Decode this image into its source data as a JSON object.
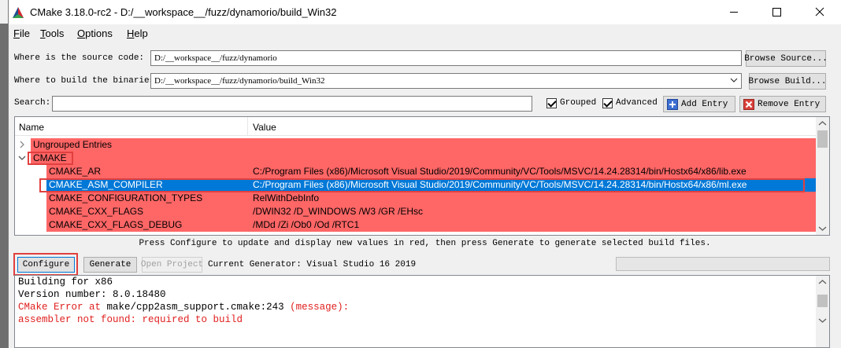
{
  "window": {
    "title": "CMake 3.18.0-rc2 - D:/__workspace__/fuzz/dynamorio/build_Win32"
  },
  "menu": [
    {
      "label": "File",
      "accel": "F",
      "rest": "ile"
    },
    {
      "label": "Tools",
      "accel": "T",
      "rest": "ools"
    },
    {
      "label": "Options",
      "accel": "O",
      "rest": "ptions"
    },
    {
      "label": "Help",
      "accel": "H",
      "rest": "elp"
    }
  ],
  "source": {
    "label": "Where is the source code:",
    "value": "D:/__workspace__/fuzz/dynamorio",
    "browse": "Browse Source..."
  },
  "build": {
    "label": "Where to build the binaries:",
    "value": "D:/__workspace__/fuzz/dynamorio/build_Win32",
    "browse": "Browse Build..."
  },
  "search": {
    "label": "Search:",
    "value": "",
    "grouped": {
      "label": "Grouped",
      "checked": true
    },
    "advanced": {
      "label": "Advanced",
      "checked": true
    },
    "add_entry": "Add Entry",
    "remove_entry": "Remove Entry"
  },
  "tree": {
    "headers": {
      "name": "Name",
      "value": "Value"
    },
    "groups": [
      {
        "name": "Ungrouped Entries",
        "expanded": false
      },
      {
        "name": "CMAKE",
        "expanded": true
      }
    ],
    "rows": [
      {
        "name": "CMAKE_AR",
        "value": "C:/Program Files (x86)/Microsoft Visual Studio/2019/Community/VC/Tools/MSVC/14.24.28314/bin/Hostx64/x86/lib.exe",
        "selected": false
      },
      {
        "name": "CMAKE_ASM_COMPILER",
        "value": "C:/Program Files (x86)/Microsoft Visual Studio/2019/Community/VC/Tools/MSVC/14.24.28314/bin/Hostx64/x86/ml.exe",
        "selected": true
      },
      {
        "name": "CMAKE_CONFIGURATION_TYPES",
        "value": "RelWithDebInfo",
        "selected": false
      },
      {
        "name": "CMAKE_CXX_FLAGS",
        "value": "/DWIN32 /D_WINDOWS /W3 /GR /EHsc",
        "selected": false
      },
      {
        "name": "CMAKE_CXX_FLAGS_DEBUG",
        "value": "/MDd /Zi /Ob0 /Od /RTC1",
        "selected": false
      }
    ]
  },
  "status_text": "Press Configure to update and display new values in red, then press Generate to generate selected build files.",
  "actions": {
    "configure": "Configure",
    "generate": "Generate",
    "open_project": "Open Project",
    "generator_label": "Current Generator: Visual Studio 16 2019"
  },
  "output": [
    {
      "text": "Building for x86",
      "color": "#000000"
    },
    {
      "text": "Version number: 8.0.18480",
      "color": "#000000"
    },
    {
      "prefix": "CMake Error at ",
      "file": "make/cpp2asm_support.cmake:243",
      "suffix": " (message):",
      "color": "#e0201f"
    },
    {
      "text": "  assembler not found: required to build",
      "color": "#e0201f"
    }
  ],
  "colors": {
    "changed_row": "#ff6666",
    "selected_row": "#0078d7",
    "highlight_box": "#e0403f"
  }
}
